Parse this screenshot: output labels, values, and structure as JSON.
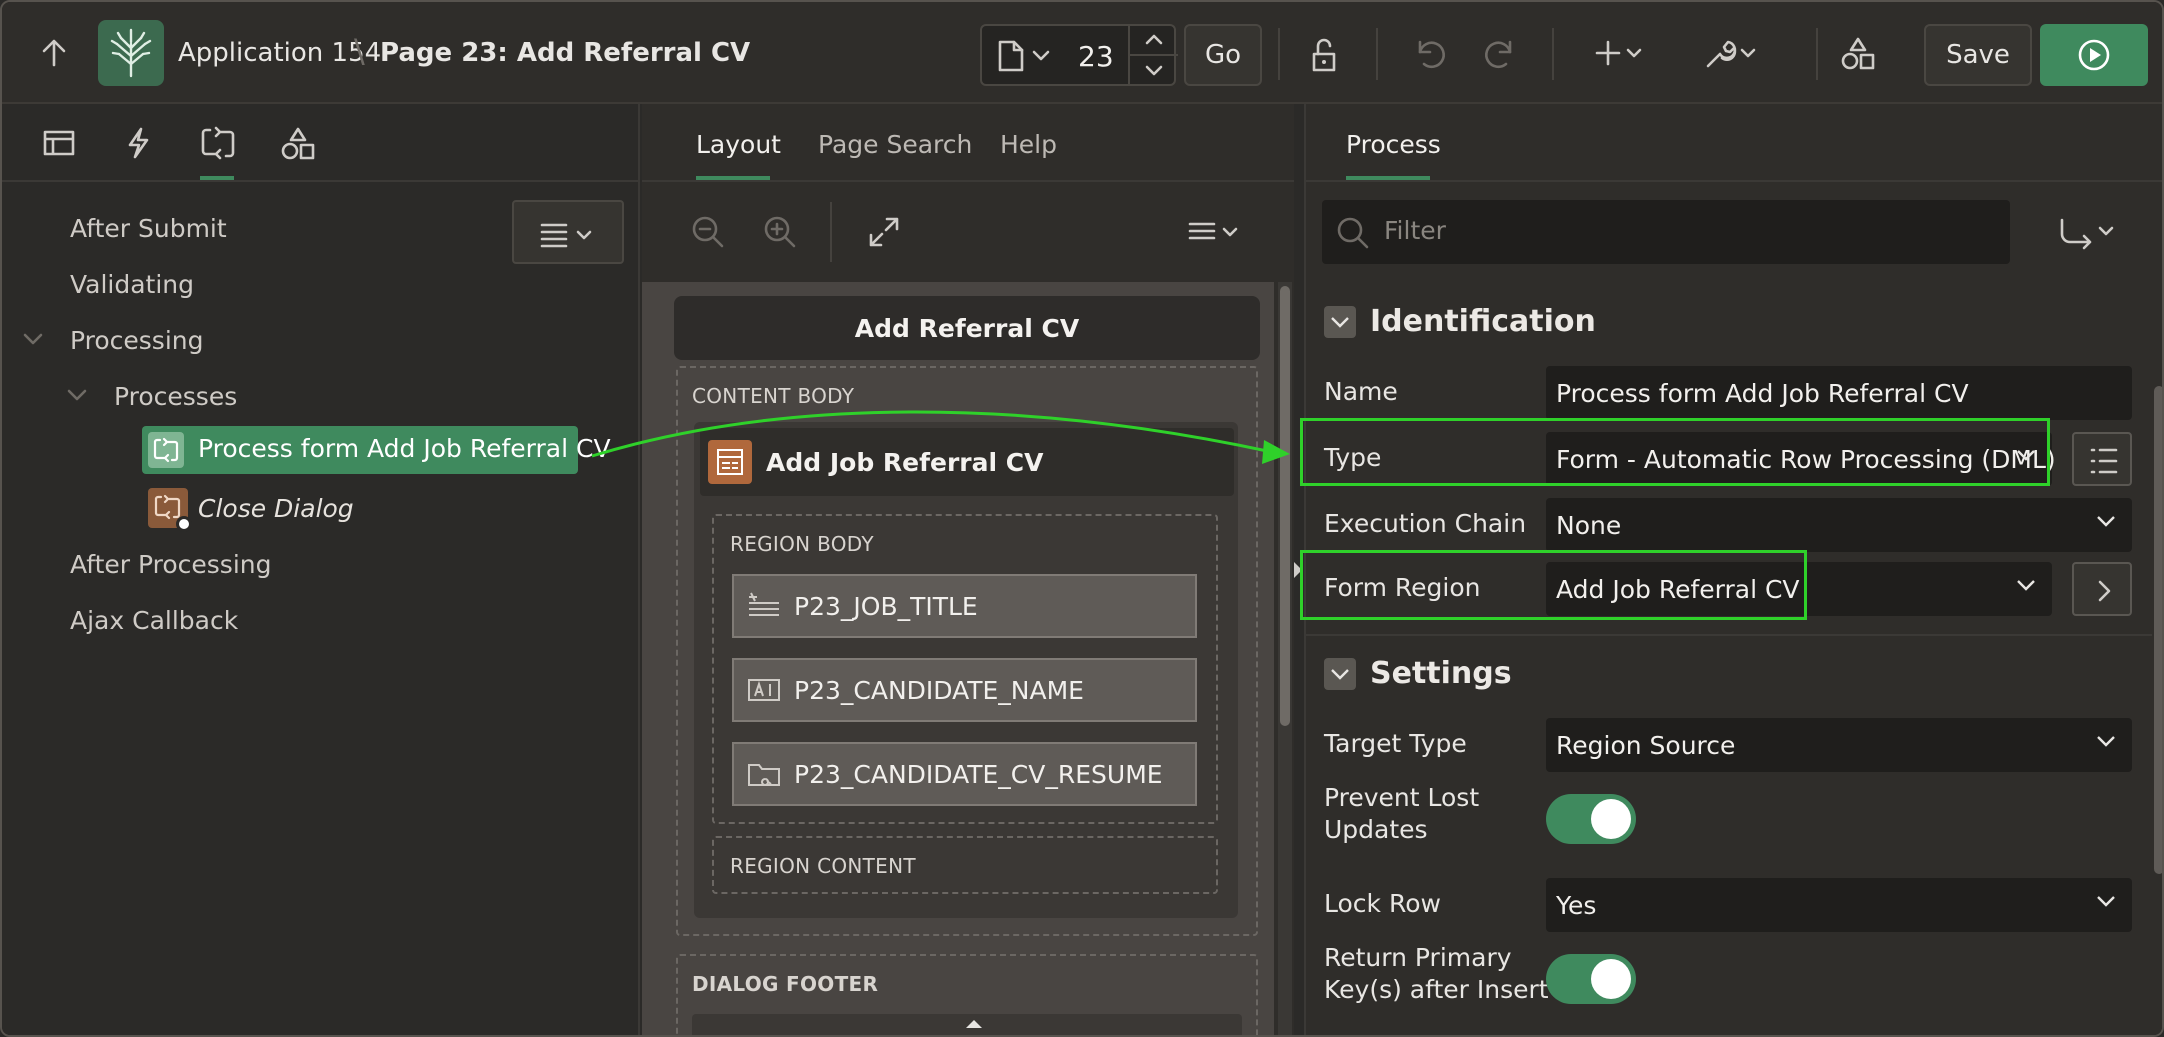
{
  "header": {
    "app_name": "Application 154",
    "separator": "\\",
    "page_title": "Page 23: Add Referral CV",
    "page_number": "23",
    "go_label": "Go",
    "save_label": "Save"
  },
  "left_panel": {
    "tabs": [
      "rendering-tab",
      "dynamic-actions-tab",
      "processing-tab",
      "shared-components-tab"
    ],
    "active_tab": "processing-tab",
    "tree": {
      "after_submit": "After Submit",
      "validating": "Validating",
      "processing": "Processing",
      "processes": "Processes",
      "process_form": "Process form Add Job Referral CV",
      "close_dialog": "Close Dialog",
      "after_processing": "After Processing",
      "ajax_callback": "Ajax Callback"
    }
  },
  "middle_panel": {
    "tabs": {
      "layout": "Layout",
      "page_search": "Page Search",
      "help": "Help"
    },
    "active_tab": "Layout",
    "dialog_title": "Add Referral CV",
    "content_body": "CONTENT BODY",
    "region_title": "Add Job Referral CV",
    "region_body": "REGION BODY",
    "items": [
      "P23_JOB_TITLE",
      "P23_CANDIDATE_NAME",
      "P23_CANDIDATE_CV_RESUME"
    ],
    "region_content": "REGION CONTENT",
    "dialog_footer": "DIALOG FOOTER"
  },
  "right_panel": {
    "tab": "Process",
    "filter_placeholder": "Filter",
    "identification": {
      "heading": "Identification",
      "name_label": "Name",
      "name_value": "Process form Add Job Referral CV",
      "type_label": "Type",
      "type_value": "Form - Automatic Row Processing (DML)",
      "execution_chain_label": "Execution Chain",
      "execution_chain_value": "None",
      "form_region_label": "Form Region",
      "form_region_value": "Add Job Referral CV"
    },
    "settings": {
      "heading": "Settings",
      "target_type_label": "Target Type",
      "target_type_value": "Region Source",
      "prevent_lost_updates_label_1": "Prevent Lost",
      "prevent_lost_updates_label_2": "Updates",
      "prevent_lost_updates_on": true,
      "lock_row_label": "Lock Row",
      "lock_row_value": "Yes",
      "return_pk_label_1": "Return Primary",
      "return_pk_label_2": "Key(s) after Insert",
      "return_pk_on": true
    }
  },
  "colors": {
    "accent_green": "#3f8a5e",
    "highlight_green": "#2fd12a",
    "process_icon_orange": "#8a5a3a"
  }
}
